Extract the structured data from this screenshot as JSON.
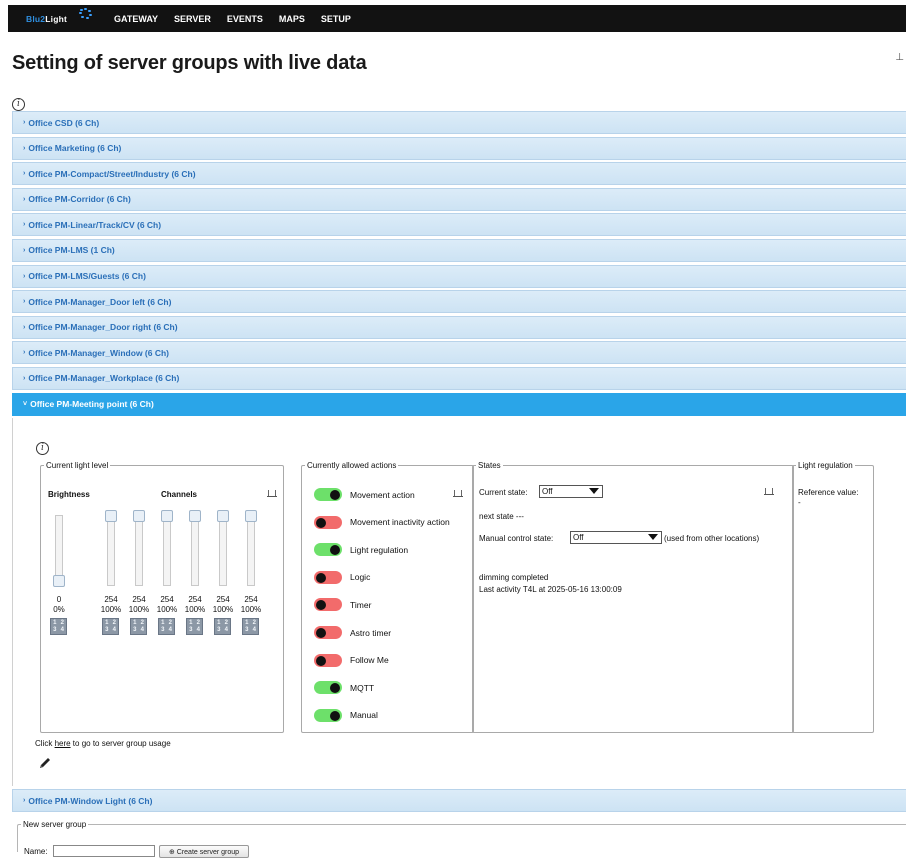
{
  "nav": {
    "logo_brand": "Blu2",
    "logo_suffix": "Light",
    "items": [
      "GATEWAY",
      "SERVER",
      "EVENTS",
      "MAPS",
      "SETUP"
    ]
  },
  "page": {
    "title": "Setting of server groups with live data",
    "info_glyph": "i"
  },
  "groups": [
    {
      "label": "Office CSD (6 Ch)",
      "active": false
    },
    {
      "label": "Office Marketing (6 Ch)",
      "active": false
    },
    {
      "label": "Office PM-Compact/Street/Industry (6 Ch)",
      "active": false
    },
    {
      "label": "Office PM-Corridor (6 Ch)",
      "active": false
    },
    {
      "label": "Office PM-Linear/Track/CV (6 Ch)",
      "active": false
    },
    {
      "label": "Office PM-LMS (1 Ch)",
      "active": false
    },
    {
      "label": "Office PM-LMS/Guests (6 Ch)",
      "active": false
    },
    {
      "label": "Office PM-Manager_Door left (6 Ch)",
      "active": false
    },
    {
      "label": "Office PM-Manager_Door right (6 Ch)",
      "active": false
    },
    {
      "label": "Office PM-Manager_Window (6 Ch)",
      "active": false
    },
    {
      "label": "Office PM-Manager_Workplace (6 Ch)",
      "active": false
    },
    {
      "label": "Office PM-Meeting point (6 Ch)",
      "active": true
    }
  ],
  "group_after": {
    "label": "Office PM-Window Light (6 Ch)"
  },
  "light_level": {
    "legend": "Current light level",
    "brightness_label": "Brightness",
    "channels_label": "Channels",
    "brightness": {
      "value": "0",
      "percent": "0%",
      "level": 0.0
    },
    "channels": [
      {
        "value": "254",
        "percent": "100%",
        "level": 1.0
      },
      {
        "value": "254",
        "percent": "100%",
        "level": 1.0
      },
      {
        "value": "254",
        "percent": "100%",
        "level": 1.0
      },
      {
        "value": "254",
        "percent": "100%",
        "level": 1.0
      },
      {
        "value": "254",
        "percent": "100%",
        "level": 1.0
      },
      {
        "value": "254",
        "percent": "100%",
        "level": 1.0
      }
    ],
    "button_digits": [
      "1",
      "2",
      "3",
      "4"
    ]
  },
  "actions": {
    "legend": "Currently allowed actions",
    "items": [
      {
        "label": "Movement action",
        "on": true
      },
      {
        "label": "Movement inactivity action",
        "on": false
      },
      {
        "label": "Light regulation",
        "on": true
      },
      {
        "label": "Logic",
        "on": false
      },
      {
        "label": "Timer",
        "on": false
      },
      {
        "label": "Astro timer",
        "on": false
      },
      {
        "label": "Follow Me",
        "on": false
      },
      {
        "label": "MQTT",
        "on": true
      },
      {
        "label": "Manual",
        "on": true
      }
    ]
  },
  "states": {
    "legend": "States",
    "current_state_label": "Current state:",
    "current_state_value": "Off",
    "next_state": "next state ---",
    "manual_label": "Manual control state:",
    "manual_value": "Off",
    "manual_note": "(used from other locations)",
    "dimming": "dimming completed",
    "last_activity": "Last activity T4L at 2025-05-16 13:00:09"
  },
  "regulation": {
    "legend": "Light regulation",
    "reference_label": "Reference value:",
    "reference_value": "-"
  },
  "footer_link": {
    "prefix": "Click ",
    "link": "here",
    "suffix": " to go to server group usage"
  },
  "new_group": {
    "legend": "New server group",
    "name_label": "Name:",
    "name_value": "",
    "create_label": "⊕ Create server group"
  },
  "colors": {
    "nav_bg": "#121212",
    "row_bg": "#d6e8f6",
    "row_text": "#2a6fb8",
    "active_row": "#2aa5e8",
    "toggle_on": "#6de06a",
    "toggle_off": "#f26b6b"
  }
}
